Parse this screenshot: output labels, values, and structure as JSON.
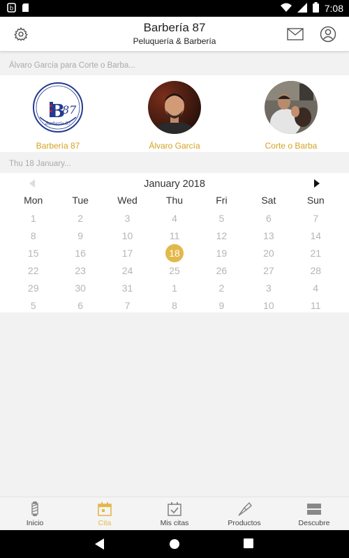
{
  "status_bar": {
    "time": "7:08",
    "icons": [
      "notification-icon",
      "sd-card-icon",
      "wifi-icon",
      "cell-signal-icon",
      "battery-icon"
    ]
  },
  "header": {
    "title": "Barbería 87",
    "subtitle": "Peluquería & Barbería",
    "icons": [
      "gear-icon",
      "mail-icon",
      "user-icon"
    ]
  },
  "selection_summary": "Álvaro García para Corte o Barba...",
  "staff": [
    {
      "name": "Barbería 87",
      "logo_text_main": "B87",
      "logo_text_bottom": "Barbería 87"
    },
    {
      "name": "Álvaro García"
    },
    {
      "name": "Corte o Barba"
    }
  ],
  "date_summary": "Thu 18 January...",
  "calendar": {
    "month_label": "January 2018",
    "weekdays": [
      "Mon",
      "Tue",
      "Wed",
      "Thu",
      "Fri",
      "Sat",
      "Sun"
    ],
    "weeks": [
      [
        "1",
        "2",
        "3",
        "4",
        "5",
        "6",
        "7"
      ],
      [
        "8",
        "9",
        "10",
        "11",
        "12",
        "13",
        "14"
      ],
      [
        "15",
        "16",
        "17",
        "18",
        "19",
        "20",
        "21"
      ],
      [
        "22",
        "23",
        "24",
        "25",
        "26",
        "27",
        "28"
      ],
      [
        "29",
        "30",
        "31",
        "1",
        "2",
        "3",
        "4"
      ],
      [
        "5",
        "6",
        "7",
        "8",
        "9",
        "10",
        "11"
      ]
    ],
    "selected_day": "18",
    "selected_color": "#e2b84a"
  },
  "tabs": [
    {
      "label": "Inicio",
      "icon": "barber-pole-icon",
      "active": false
    },
    {
      "label": "Cita",
      "icon": "calendar-icon",
      "active": true
    },
    {
      "label": "Mis citas",
      "icon": "calendar-check-icon",
      "active": false
    },
    {
      "label": "Productos",
      "icon": "razor-icon",
      "active": false
    },
    {
      "label": "Descubre",
      "icon": "list-icon",
      "active": false
    }
  ],
  "accent_color": "#d4a21f"
}
